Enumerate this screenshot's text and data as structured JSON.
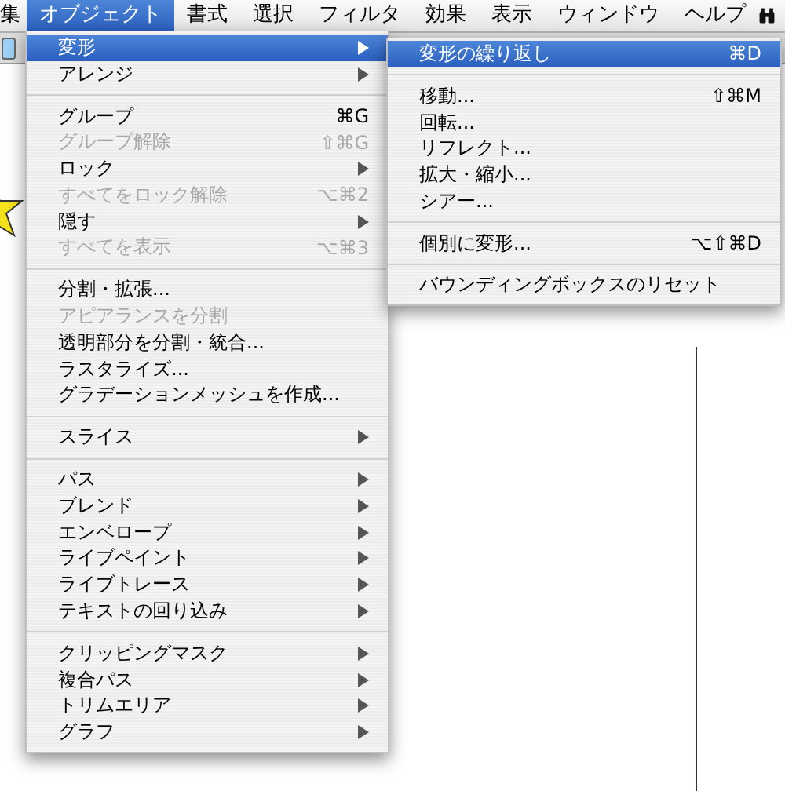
{
  "menu_bar": {
    "items": [
      {
        "label": "集",
        "selected": false
      },
      {
        "label": "オブジェクト",
        "selected": true
      },
      {
        "label": "書式",
        "selected": false
      },
      {
        "label": "選択",
        "selected": false
      },
      {
        "label": "フィルタ",
        "selected": false
      },
      {
        "label": "効果",
        "selected": false
      },
      {
        "label": "表示",
        "selected": false
      },
      {
        "label": "ウィンドウ",
        "selected": false
      },
      {
        "label": "ヘルプ",
        "selected": false
      }
    ]
  },
  "object_menu": {
    "items": [
      {
        "kind": "item",
        "label": "変形",
        "submenu": true,
        "disabled": false,
        "selected": true
      },
      {
        "kind": "item",
        "label": "アレンジ",
        "submenu": true,
        "disabled": false,
        "selected": false
      },
      {
        "kind": "separator"
      },
      {
        "kind": "item",
        "label": "グループ",
        "shortcut": "⌘G",
        "disabled": false,
        "selected": false
      },
      {
        "kind": "item",
        "label": "グループ解除",
        "shortcut": "⇧⌘G",
        "disabled": true,
        "selected": false
      },
      {
        "kind": "item",
        "label": "ロック",
        "submenu": true,
        "disabled": false,
        "selected": false
      },
      {
        "kind": "item",
        "label": "すべてをロック解除",
        "shortcut": "⌥⌘2",
        "disabled": true,
        "selected": false
      },
      {
        "kind": "item",
        "label": "隠す",
        "submenu": true,
        "disabled": false,
        "selected": false
      },
      {
        "kind": "item",
        "label": "すべてを表示",
        "shortcut": "⌥⌘3",
        "disabled": true,
        "selected": false
      },
      {
        "kind": "separator"
      },
      {
        "kind": "item",
        "label": "分割・拡張...",
        "disabled": false,
        "selected": false
      },
      {
        "kind": "item",
        "label": "アピアランスを分割",
        "disabled": true,
        "selected": false
      },
      {
        "kind": "item",
        "label": "透明部分を分割・統合...",
        "disabled": false,
        "selected": false
      },
      {
        "kind": "item",
        "label": "ラスタライズ...",
        "disabled": false,
        "selected": false
      },
      {
        "kind": "item",
        "label": "グラデーションメッシュを作成...",
        "disabled": false,
        "selected": false
      },
      {
        "kind": "separator"
      },
      {
        "kind": "item",
        "label": "スライス",
        "submenu": true,
        "disabled": false,
        "selected": false
      },
      {
        "kind": "separator"
      },
      {
        "kind": "item",
        "label": "パス",
        "submenu": true,
        "disabled": false,
        "selected": false
      },
      {
        "kind": "item",
        "label": "ブレンド",
        "submenu": true,
        "disabled": false,
        "selected": false
      },
      {
        "kind": "item",
        "label": "エンベロープ",
        "submenu": true,
        "disabled": false,
        "selected": false
      },
      {
        "kind": "item",
        "label": "ライブペイント",
        "submenu": true,
        "disabled": false,
        "selected": false
      },
      {
        "kind": "item",
        "label": "ライブトレース",
        "submenu": true,
        "disabled": false,
        "selected": false
      },
      {
        "kind": "item",
        "label": "テキストの回り込み",
        "submenu": true,
        "disabled": false,
        "selected": false
      },
      {
        "kind": "separator"
      },
      {
        "kind": "item",
        "label": "クリッピングマスク",
        "submenu": true,
        "disabled": false,
        "selected": false
      },
      {
        "kind": "item",
        "label": "複合パス",
        "submenu": true,
        "disabled": false,
        "selected": false
      },
      {
        "kind": "item",
        "label": "トリムエリア",
        "submenu": true,
        "disabled": false,
        "selected": false
      },
      {
        "kind": "item",
        "label": "グラフ",
        "submenu": true,
        "disabled": false,
        "selected": false
      }
    ]
  },
  "transform_submenu": {
    "items": [
      {
        "kind": "item",
        "label": "変形の繰り返し",
        "shortcut": "⌘D",
        "disabled": false,
        "selected": true
      },
      {
        "kind": "separator"
      },
      {
        "kind": "item",
        "label": "移動...",
        "shortcut": "⇧⌘M",
        "disabled": false,
        "selected": false
      },
      {
        "kind": "item",
        "label": "回転...",
        "disabled": false,
        "selected": false
      },
      {
        "kind": "item",
        "label": "リフレクト...",
        "disabled": false,
        "selected": false
      },
      {
        "kind": "item",
        "label": "拡大・縮小...",
        "disabled": false,
        "selected": false
      },
      {
        "kind": "item",
        "label": "シアー...",
        "disabled": false,
        "selected": false
      },
      {
        "kind": "separator"
      },
      {
        "kind": "item",
        "label": "個別に変形...",
        "shortcut": "⌥⇧⌘D",
        "disabled": false,
        "selected": false
      },
      {
        "kind": "separator"
      },
      {
        "kind": "item",
        "label": "バウンディングボックスのリセット",
        "disabled": false,
        "selected": false
      }
    ]
  }
}
